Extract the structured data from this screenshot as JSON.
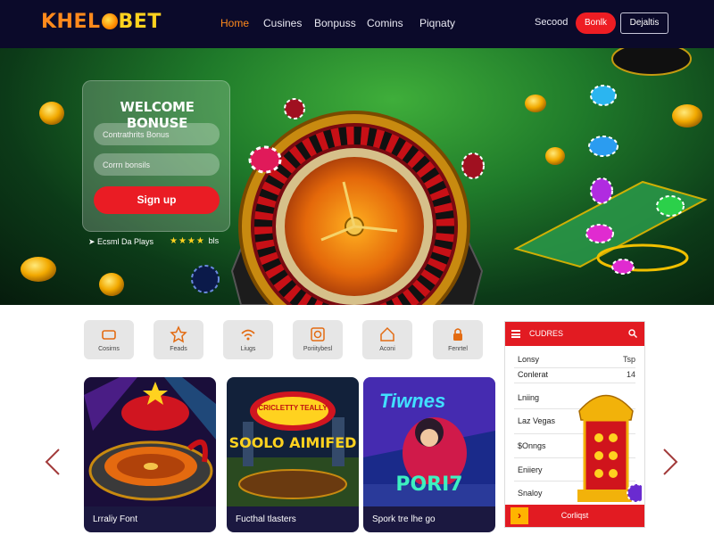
{
  "nav": {
    "logo_part1": "KHEL",
    "logo_part2": "BET",
    "links": [
      "Home",
      "Cusines",
      "Bonpuss",
      "Comins",
      "Piqnaty"
    ],
    "secondary_link": "Secood",
    "primary_button": "Bonlk",
    "outline_button": "Dejaltis"
  },
  "hero": {
    "title": "WELCOME BONUSE",
    "input1_placeholder": "Contrathrits Bonus",
    "input2_placeholder": "Corrn bonsils",
    "signup_label": "Sign up",
    "note": "Ecsml Da Plays",
    "rating_text": "bls",
    "rating_stars": 4
  },
  "categories": [
    {
      "label": "Cosirns",
      "icon": "casino-icon"
    },
    {
      "label": "Feads",
      "icon": "star-icon"
    },
    {
      "label": "Liugs",
      "icon": "wifi-icon"
    },
    {
      "label": "Poriitybesl",
      "icon": "roulette-icon"
    },
    {
      "label": "Aconi",
      "icon": "house-icon"
    },
    {
      "label": "Fenrtel",
      "icon": "lock-icon"
    }
  ],
  "games": [
    {
      "caption": "Lrraliy Font",
      "art_title": ""
    },
    {
      "caption": "Fucthal tlasters",
      "art_title": "SOOLO AIMIFED",
      "art_badge": "CRICLETTY TEALLY"
    },
    {
      "caption": "Spork tre lhe go",
      "art_title": "PORI7",
      "art_badge": "Tiwnes"
    }
  ],
  "panel": {
    "title": "CUDRES",
    "rows": [
      {
        "label": "Lonsy",
        "value": "Tsp"
      },
      {
        "label": "Conlerat",
        "value": "14"
      },
      {
        "label": "Lniing",
        "value": ""
      },
      {
        "label": "Laz Vegas",
        "value": ""
      },
      {
        "label": "$Onngs",
        "value": ""
      },
      {
        "label": "Eniiery",
        "value": ""
      },
      {
        "label": "Snaloy",
        "value": ""
      }
    ],
    "footer": "Corliqst",
    "footer_chevron": "›"
  },
  "colors": {
    "nav_bg": "#0b0a2a",
    "accent_orange": "#ff8a1c",
    "accent_red": "#e21b22",
    "hero_green": "#1f7a2a"
  }
}
